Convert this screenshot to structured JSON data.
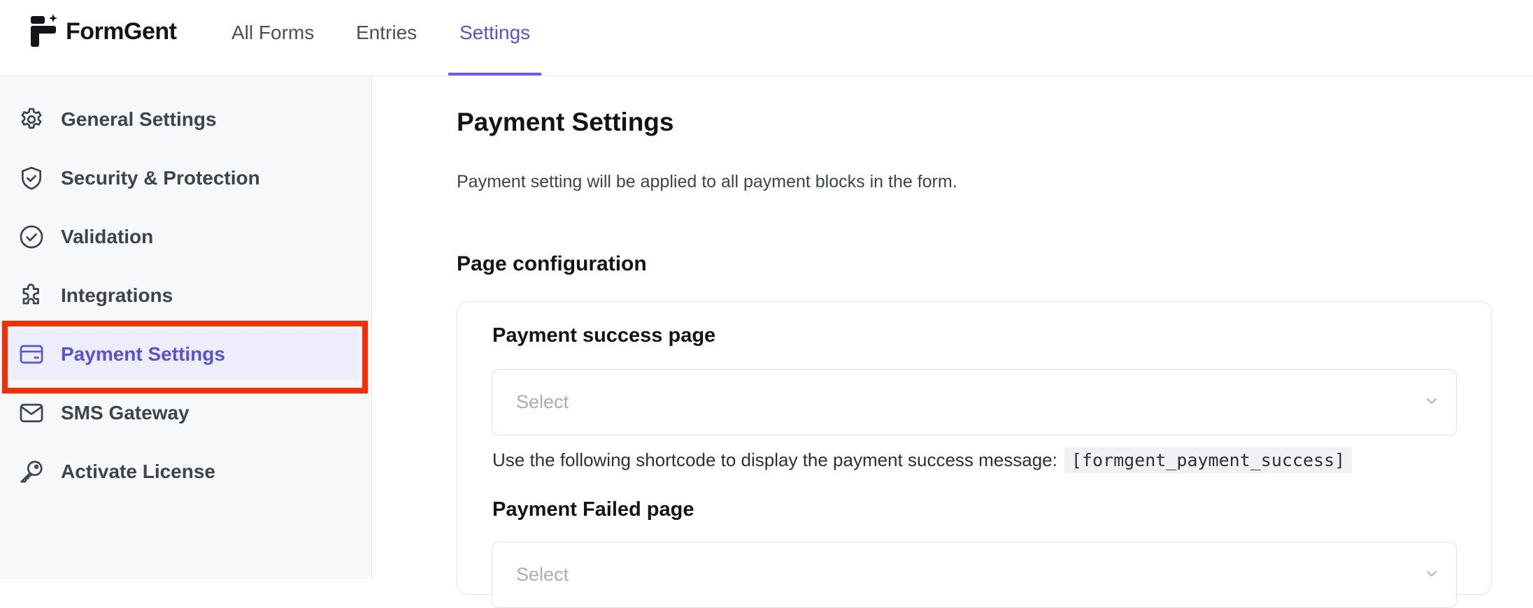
{
  "brand": {
    "name": "FormGent"
  },
  "nav": {
    "tabs": [
      {
        "label": "All Forms"
      },
      {
        "label": "Entries"
      },
      {
        "label": "Settings",
        "active": true
      }
    ]
  },
  "sidebar": {
    "items": [
      {
        "label": "General Settings",
        "icon": "gear-icon"
      },
      {
        "label": "Security & Protection",
        "icon": "shield-icon"
      },
      {
        "label": "Validation",
        "icon": "check-circle-icon"
      },
      {
        "label": "Integrations",
        "icon": "puzzle-icon"
      },
      {
        "label": "Payment Settings",
        "icon": "credit-card-icon",
        "active": true
      },
      {
        "label": "SMS Gateway",
        "icon": "mail-icon"
      },
      {
        "label": "Activate License",
        "icon": "key-icon"
      }
    ]
  },
  "main": {
    "title": "Payment Settings",
    "description": "Payment setting will be applied to all payment blocks in the form.",
    "section_title": "Page configuration",
    "success": {
      "label": "Payment success page",
      "placeholder": "Select",
      "help_text": "Use the following shortcode to display the payment success message:",
      "shortcode": "[formgent_payment_success]"
    },
    "failed": {
      "label": "Payment Failed page",
      "placeholder": "Select"
    }
  },
  "colors": {
    "accent": "#5b4fe0",
    "active_bg": "#eeedfc",
    "highlight": "#ff2a00",
    "sidebar_bg": "#f7f8fa"
  }
}
